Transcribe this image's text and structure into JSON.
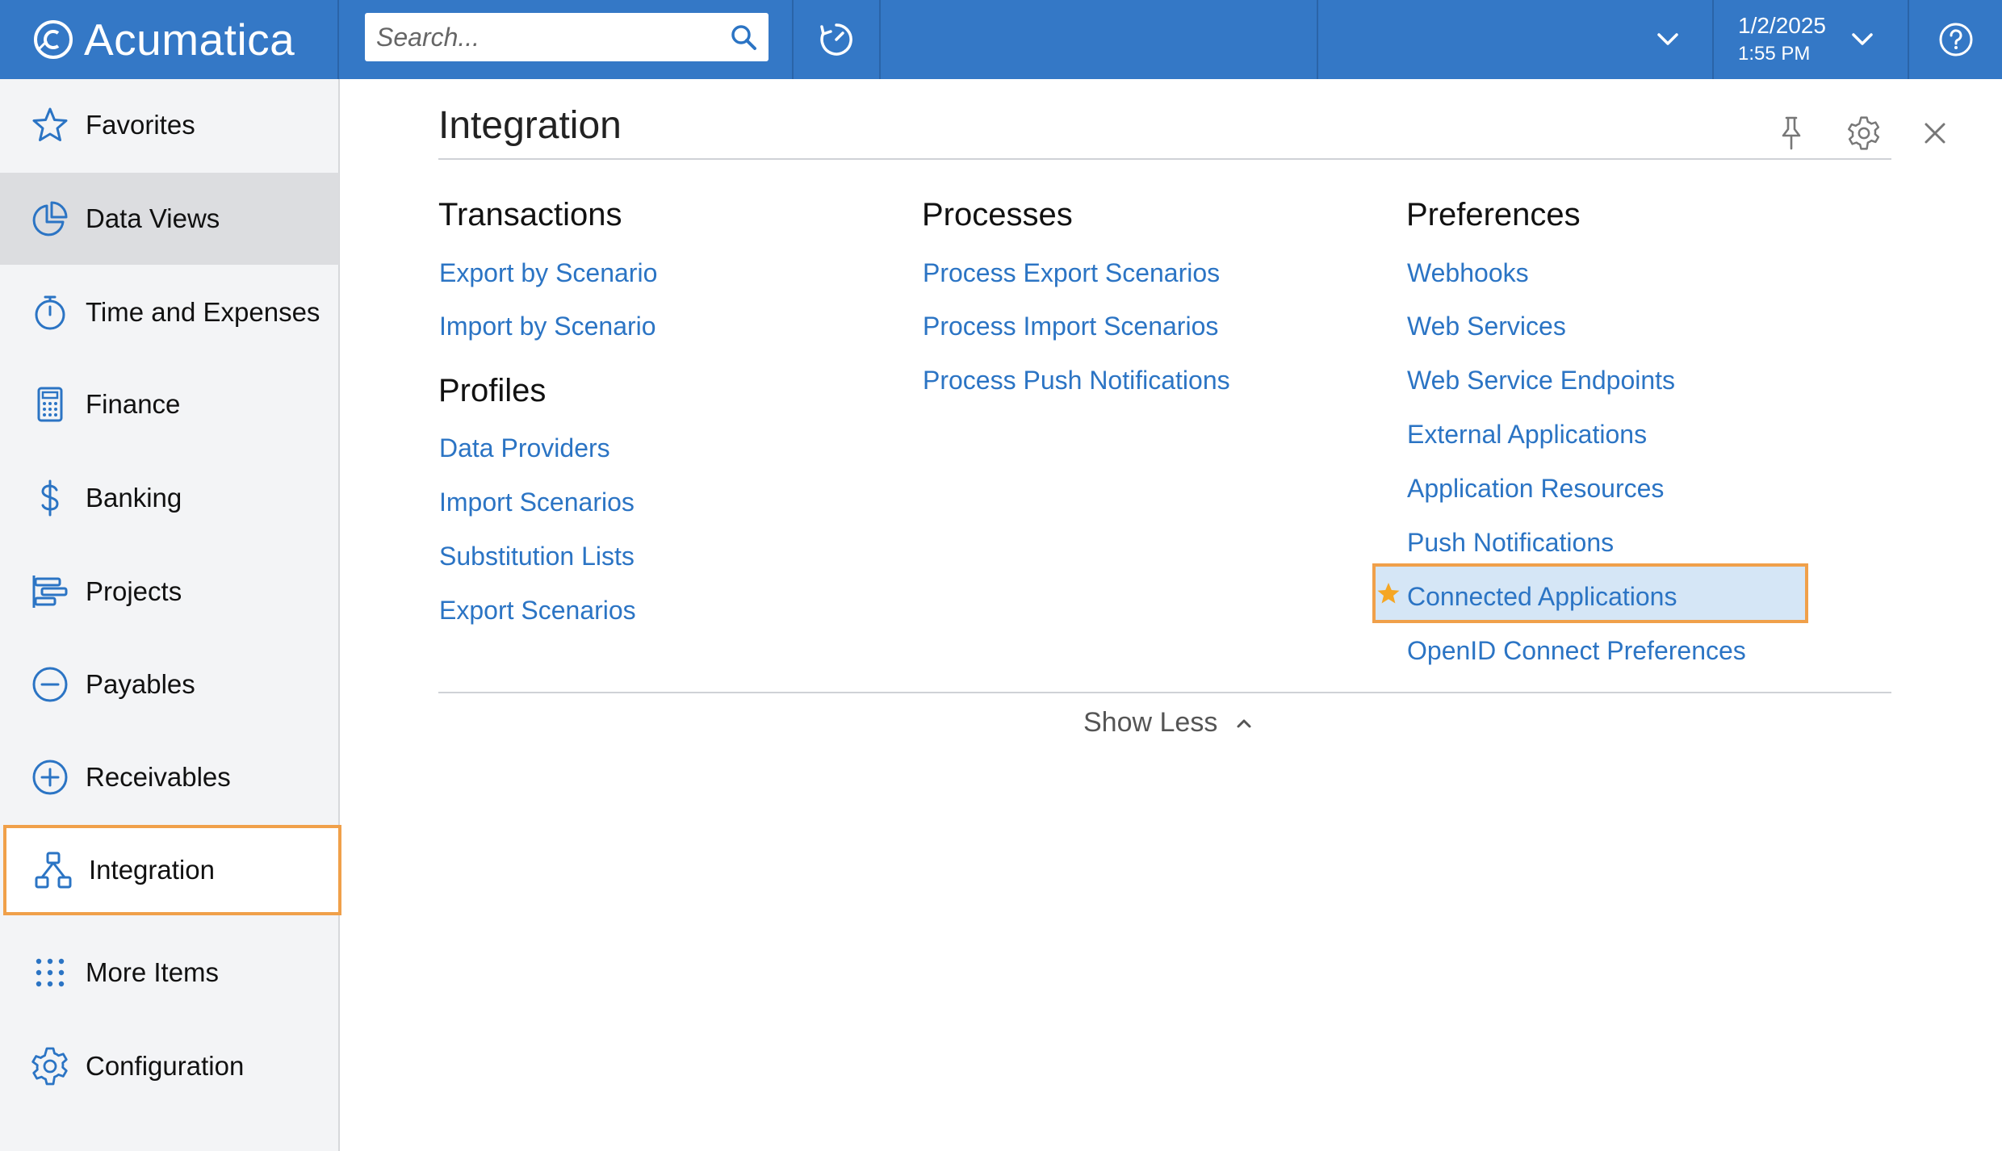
{
  "header": {
    "logo_text": "Acumatica",
    "search_placeholder": "Search...",
    "date": "1/2/2025",
    "time": "1:55 PM"
  },
  "sidebar": {
    "items": [
      {
        "label": "Favorites",
        "icon": "star-icon"
      },
      {
        "label": "Data Views",
        "icon": "pie-chart-icon"
      },
      {
        "label": "Time and Expenses",
        "icon": "stopwatch-icon"
      },
      {
        "label": "Finance",
        "icon": "calculator-icon"
      },
      {
        "label": "Banking",
        "icon": "dollar-icon"
      },
      {
        "label": "Projects",
        "icon": "gantt-icon"
      },
      {
        "label": "Payables",
        "icon": "minus-circle-icon"
      },
      {
        "label": "Receivables",
        "icon": "plus-circle-icon"
      },
      {
        "label": "Integration",
        "icon": "hierarchy-icon"
      },
      {
        "label": "More Items",
        "icon": "grid-dots-icon"
      },
      {
        "label": "Configuration",
        "icon": "gear-icon"
      }
    ]
  },
  "panel": {
    "title": "Integration",
    "show_less": "Show Less",
    "groups": {
      "transactions": {
        "title": "Transactions",
        "links": [
          "Export by Scenario",
          "Import by Scenario"
        ]
      },
      "profiles": {
        "title": "Profiles",
        "links": [
          "Data Providers",
          "Import Scenarios",
          "Substitution Lists",
          "Export Scenarios"
        ]
      },
      "processes": {
        "title": "Processes",
        "links": [
          "Process Export Scenarios",
          "Process Import Scenarios",
          "Process Push Notifications"
        ]
      },
      "preferences": {
        "title": "Preferences",
        "links": [
          "Webhooks",
          "Web Services",
          "Web Service Endpoints",
          "External Applications",
          "Application Resources",
          "Push Notifications",
          "Connected Applications",
          "OpenID Connect Preferences"
        ]
      }
    }
  },
  "colors": {
    "topbar": "#3478c6",
    "link": "#2b74c4",
    "highlight_border": "#f0a04a",
    "highlight_fill": "#d5e6f6",
    "star": "#f5a623"
  }
}
